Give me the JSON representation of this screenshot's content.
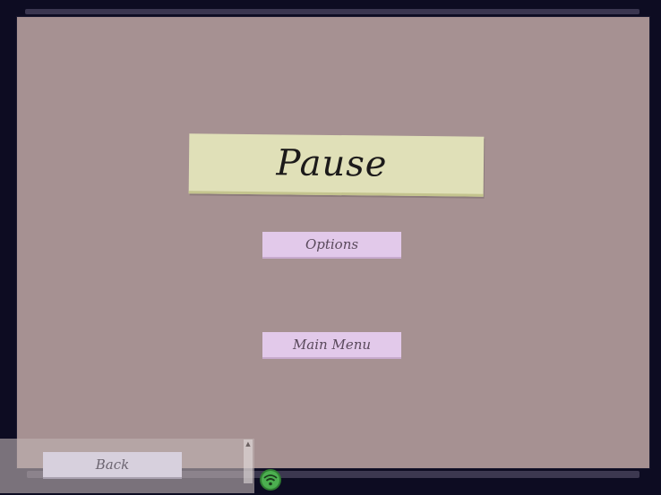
{
  "pause_menu": {
    "title": "Pause",
    "buttons": {
      "options": "Options",
      "main_menu": "Main Menu"
    }
  },
  "navigation": {
    "back_label": "Back"
  },
  "icons": {
    "scroll_up": "chevron-up-icon",
    "status": "wifi-signal-icon"
  },
  "colors": {
    "background": "#0d0c22",
    "panel": "#a69192",
    "title_card": "#e0e0b8",
    "menu_button": "#e2c9ea",
    "back_button": "#d7d0dd",
    "status_icon": "#4caf50"
  }
}
